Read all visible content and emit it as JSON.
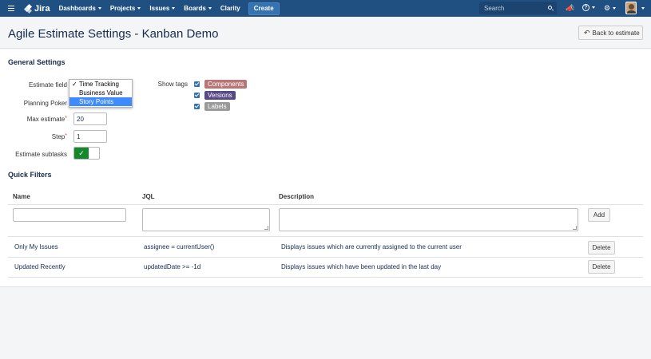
{
  "nav": {
    "logo": "Jira",
    "items": [
      "Dashboards",
      "Projects",
      "Issues",
      "Boards"
    ],
    "clarity": "Clarity",
    "create": "Create",
    "search_placeholder": "Search"
  },
  "header": {
    "title": "Agile Estimate Settings - Kanban Demo",
    "back_label": "Back to estimate"
  },
  "general": {
    "title": "General Settings",
    "estimate_field_label": "Estimate field",
    "planning_poker_label": "Planning Poker",
    "max_estimate_label": "Max estimate",
    "max_estimate_value": "20",
    "step_label": "Step",
    "step_value": "1",
    "estimate_subtasks_label": "Estimate subtasks",
    "estimate_subtasks_on": true,
    "dropdown_options": [
      "Time Tracking",
      "Business Value",
      "Story Points"
    ],
    "dropdown_checked": "Time Tracking",
    "dropdown_highlighted": "Story Points",
    "show_tags_label": "Show tags",
    "tags": [
      {
        "label": "Components",
        "color": "#b97676",
        "checked": true
      },
      {
        "label": "Versions",
        "color": "#594a85",
        "checked": true
      },
      {
        "label": "Labels",
        "color": "#9a9a9a",
        "checked": true
      }
    ]
  },
  "quick_filters": {
    "title": "Quick Filters",
    "columns": [
      "Name",
      "JQL",
      "Description"
    ],
    "add_label": "Add",
    "delete_label": "Delete",
    "rows": [
      {
        "name": "Only My Issues",
        "jql": "assignee = currentUser()",
        "description": "Displays issues which are currently assigned to the current user"
      },
      {
        "name": "Updated Recently",
        "jql": "updatedDate >= -1d",
        "description": "Displays issues which have been updated in the last day"
      }
    ]
  },
  "colors": {
    "nav_bg": "#205081",
    "create_bg": "#3572b0",
    "toggle_on": "#14892c",
    "selected_option": "#3d8bff"
  }
}
